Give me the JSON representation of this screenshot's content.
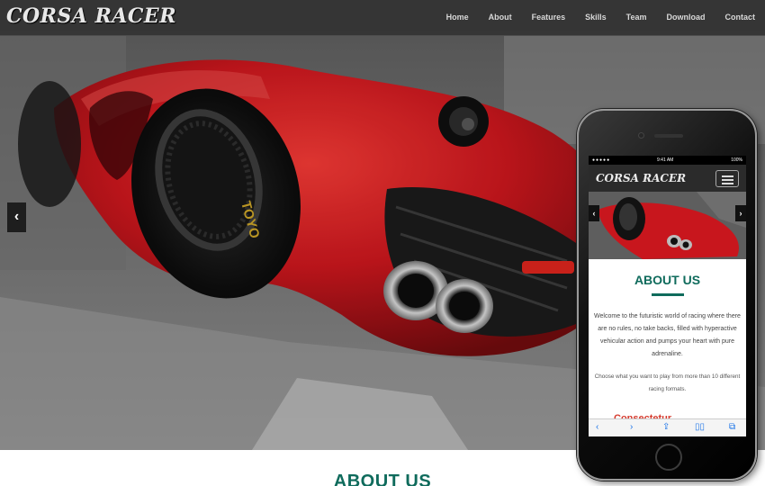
{
  "brand": "CORSA RACER",
  "nav": {
    "items": [
      "Home",
      "About",
      "Features",
      "Skills",
      "Team",
      "Download",
      "Contact"
    ]
  },
  "hero": {
    "prev_icon": "chevron-left-icon",
    "tire_text": "TOYO"
  },
  "section": {
    "title": "ABOUT US"
  },
  "phone": {
    "status_carrier": "●●●●● ",
    "status_time": "9:41 AM",
    "status_battery": "100%",
    "brand": "CORSA RACER",
    "menu_icon": "hamburger-icon",
    "slider_prev": "‹",
    "slider_next": "›",
    "about_title": "ABOUT US",
    "para1": "Welcome to the futuristic world of racing where there are no rules, no take backs, filled with hyperactive vehicular action and pumps your heart with pure adrenaline.",
    "para2": "Choose what you want to play from more than 10 different racing formats.",
    "partial_heading": "Consectetur",
    "toolbar": [
      "back-icon",
      "forward-icon",
      "share-icon",
      "bookmarks-icon",
      "tabs-icon"
    ]
  },
  "colors": {
    "accent": "#0f6b5c",
    "car_red": "#c8161d",
    "nav_bg": "#2d2d2d"
  }
}
